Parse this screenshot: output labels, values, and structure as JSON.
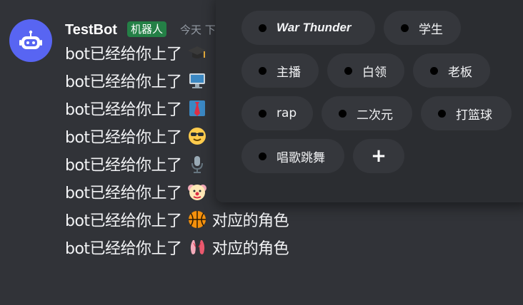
{
  "message": {
    "username": "TestBot",
    "bot_badge": "机器人",
    "timestamp": "今天 下",
    "lines": [
      {
        "prefix": "bot已经给你上了",
        "emoji": "graduation-cap-icon",
        "suffix": ""
      },
      {
        "prefix": "bot已经给你上了",
        "emoji": "computer-icon",
        "suffix": ""
      },
      {
        "prefix": "bot已经给你上了",
        "emoji": "necktie-icon",
        "suffix": ""
      },
      {
        "prefix": "bot已经给你上了",
        "emoji": "sunglasses-face-icon",
        "suffix": ""
      },
      {
        "prefix": "bot已经给你上了",
        "emoji": "microphone-icon",
        "suffix": ""
      },
      {
        "prefix": "bot已经给你上了",
        "emoji": "clown-face-icon",
        "suffix": ""
      },
      {
        "prefix": "bot已经给你上了",
        "emoji": "basketball-icon",
        "suffix": "对应的角色"
      },
      {
        "prefix": "bot已经给你上了",
        "emoji": "ballet-shoes-icon",
        "suffix": "对应的角色"
      }
    ]
  },
  "role_picker": {
    "chips": [
      {
        "label": "War Thunder"
      },
      {
        "label": "学生"
      },
      {
        "label": "主播"
      },
      {
        "label": "白领"
      },
      {
        "label": "老板"
      },
      {
        "label": "rap"
      },
      {
        "label": "二次元"
      },
      {
        "label": "打篮球"
      },
      {
        "label": "唱歌跳舞"
      }
    ],
    "add_label": "+"
  },
  "colors": {
    "background": "#313338",
    "panel": "#2b2d31",
    "chip": "#35373c",
    "bot_badge": "#248046",
    "avatar": "#5865f2"
  }
}
